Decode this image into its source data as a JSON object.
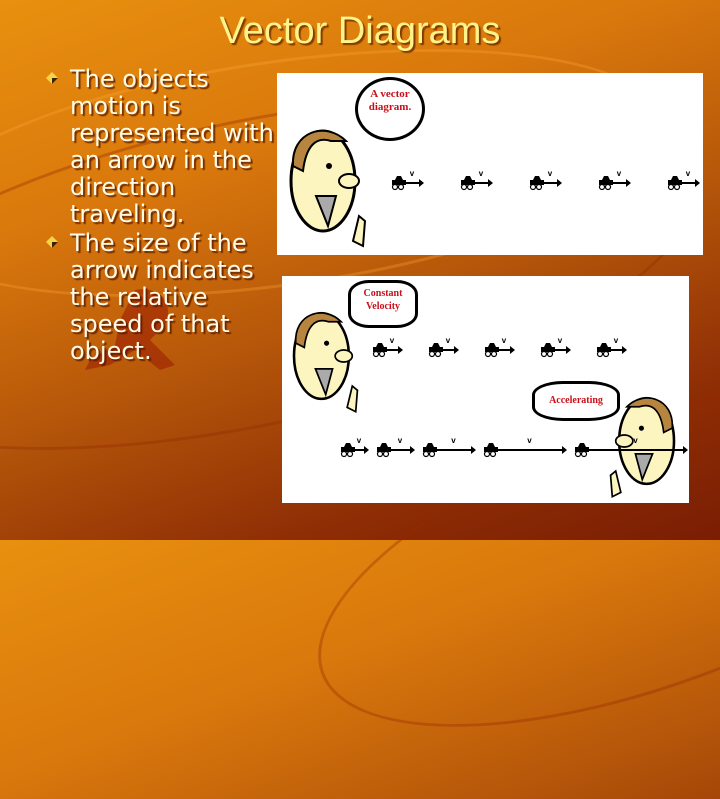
{
  "slide": {
    "title": "Vector Diagrams",
    "bullets": [
      {
        "text": "The objects motion is represented with an arrow in the direction traveling."
      },
      {
        "text": "The size of the arrow indicates the relative speed of that object."
      }
    ],
    "colors": {
      "title": "#fff48a",
      "body_text": "#fffbe6",
      "bubble_text": "#c8101a",
      "background_top": "#e8900f",
      "background_bottom": "#7a1d03"
    }
  },
  "figure_top": {
    "bubble_text": "A vector diagram.",
    "vectors": [
      {
        "label": "v",
        "relative_length": 1
      },
      {
        "label": "v",
        "relative_length": 1
      },
      {
        "label": "v",
        "relative_length": 1
      },
      {
        "label": "v",
        "relative_length": 1
      },
      {
        "label": "v",
        "relative_length": 1
      }
    ]
  },
  "figure_bottom": {
    "constant_bubble": "Constant Velocity",
    "accelerating_bubble": "Accelerating",
    "constant_vectors": [
      {
        "label": "v",
        "relative_length": 1
      },
      {
        "label": "v",
        "relative_length": 1
      },
      {
        "label": "v",
        "relative_length": 1
      },
      {
        "label": "v",
        "relative_length": 1
      },
      {
        "label": "v",
        "relative_length": 1
      }
    ],
    "accelerating_vectors": [
      {
        "label": "v",
        "relative_length": 1
      },
      {
        "label": "v",
        "relative_length": 2
      },
      {
        "label": "v",
        "relative_length": 3.5
      },
      {
        "label": "v",
        "relative_length": 6.5
      },
      {
        "label": "v",
        "relative_length": 9.5
      }
    ]
  }
}
